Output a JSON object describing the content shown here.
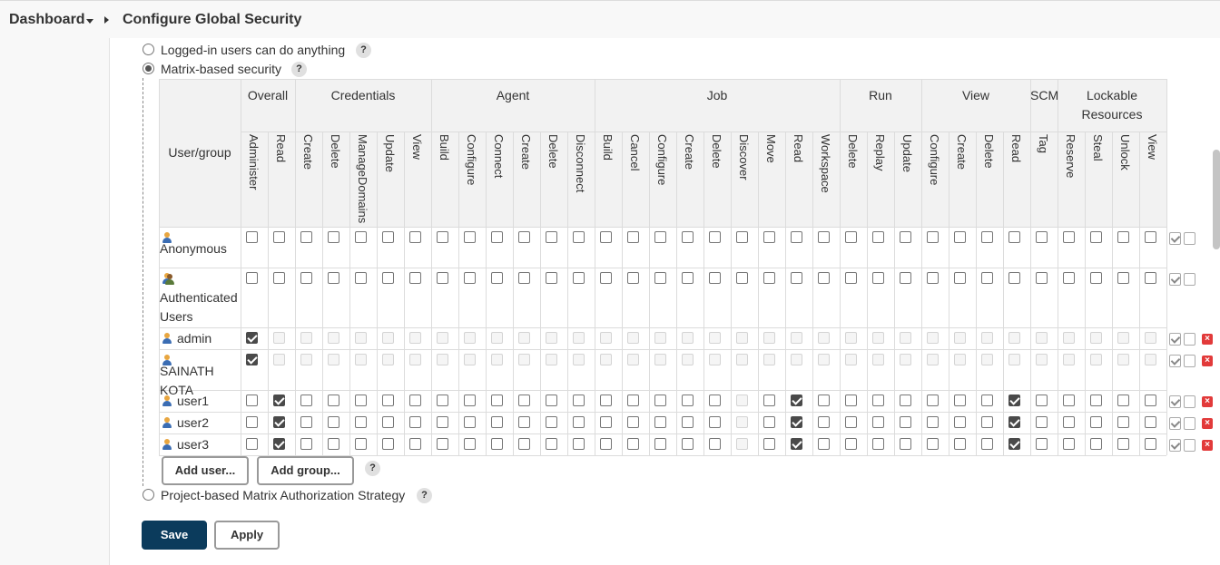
{
  "breadcrumb": {
    "dashboard": "Dashboard",
    "page": "Configure Global Security"
  },
  "options": {
    "logged_in": "Logged-in users can do anything",
    "matrix": "Matrix-based security",
    "project": "Project-based Matrix Authorization Strategy",
    "help": "?"
  },
  "matrix": {
    "user_group_header": "User/group",
    "groups": [
      {
        "name": "Overall",
        "span": 2
      },
      {
        "name": "Credentials",
        "span": 5
      },
      {
        "name": "Agent",
        "span": 6
      },
      {
        "name": "Job",
        "span": 9
      },
      {
        "name": "Run",
        "span": 3
      },
      {
        "name": "View",
        "span": 4
      },
      {
        "name": "SCM",
        "span": 1
      },
      {
        "name": "Lockable Resources",
        "span": 4
      }
    ],
    "permissions": [
      "Administer",
      "Read",
      "Create",
      "Delete",
      "ManageDomains",
      "Update",
      "View",
      "Build",
      "Configure",
      "Connect",
      "Create",
      "Delete",
      "Disconnect",
      "Build",
      "Cancel",
      "Configure",
      "Create",
      "Delete",
      "Discover",
      "Move",
      "Read",
      "Workspace",
      "Delete",
      "Replay",
      "Update",
      "Configure",
      "Create",
      "Delete",
      "Read",
      "Tag",
      "Reserve",
      "Steal",
      "Unlock",
      "View"
    ],
    "rows": [
      {
        "name": "Anonymous",
        "kind": "user",
        "checked": [],
        "disabled": [],
        "delete": false
      },
      {
        "name": "Authenticated Users",
        "kind": "group",
        "checked": [],
        "disabled": [],
        "delete": false
      },
      {
        "name": "admin",
        "kind": "user",
        "checked": [
          0
        ],
        "disabled": "others",
        "delete": true
      },
      {
        "name": "SAINATH KOTA",
        "kind": "user",
        "checked": [
          0
        ],
        "disabled": "others",
        "delete": true
      },
      {
        "name": "user1",
        "kind": "user",
        "checked": [
          1,
          20,
          28
        ],
        "disabled": [
          18
        ],
        "delete": true
      },
      {
        "name": "user2",
        "kind": "user",
        "checked": [
          1,
          20,
          28
        ],
        "disabled": [
          18
        ],
        "delete": true
      },
      {
        "name": "user3",
        "kind": "user",
        "checked": [
          1,
          20,
          28
        ],
        "disabled": [
          18
        ],
        "delete": true
      }
    ]
  },
  "buttons": {
    "add_user": "Add user...",
    "add_group": "Add group...",
    "save": "Save",
    "apply": "Apply"
  },
  "colors": {
    "save_bg": "#0b3b5c",
    "delete_red": "#e23a3a",
    "header_bg": "#f2f2f2"
  }
}
